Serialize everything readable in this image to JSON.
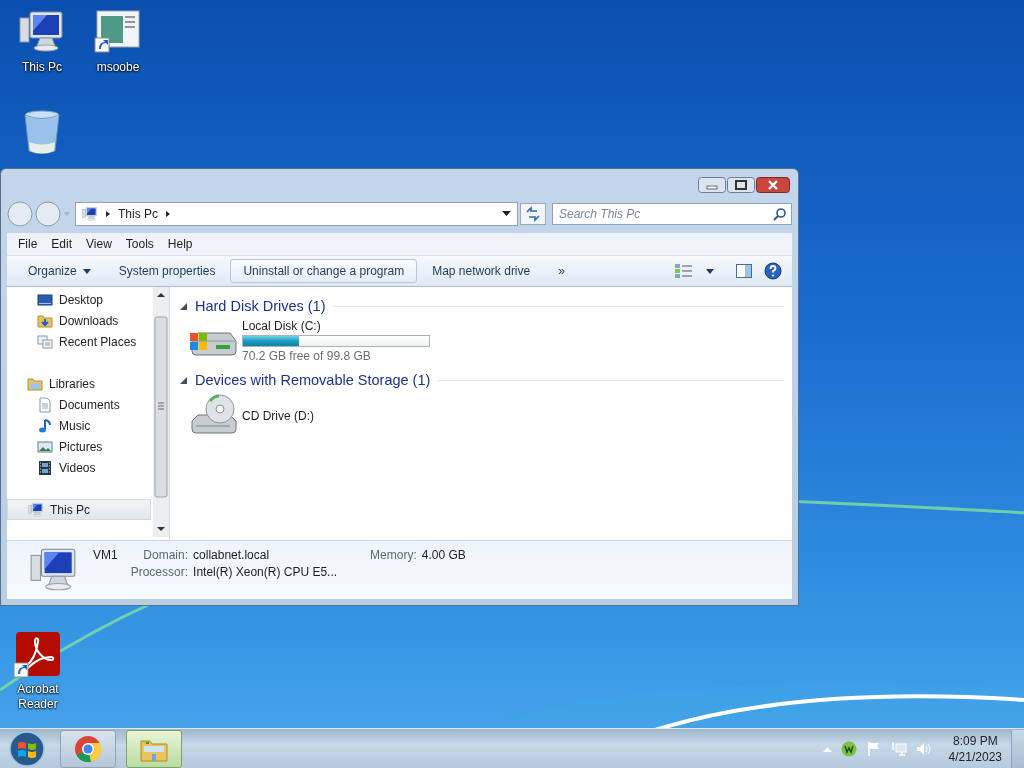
{
  "desktop": {
    "icons": [
      {
        "label": "This Pc",
        "kind": "computer"
      },
      {
        "label": "msoobe",
        "kind": "app-shortcut"
      },
      {
        "kind": "recycle-bin"
      },
      {
        "label": "Acrobat Reader",
        "kind": "pdf-shortcut"
      }
    ]
  },
  "window": {
    "breadcrumb": [
      "This Pc"
    ],
    "search": {
      "placeholder": "Search This Pc"
    },
    "menu": [
      "File",
      "Edit",
      "View",
      "Tools",
      "Help"
    ],
    "toolbar": [
      {
        "label": "Organize",
        "kind": "dropdown",
        "hovered": false
      },
      {
        "label": "System properties",
        "kind": "command",
        "hovered": false
      },
      {
        "label": "Uninstall or change a program",
        "kind": "command",
        "hovered": true
      },
      {
        "label": "Map network drive",
        "kind": "command",
        "hovered": false
      },
      {
        "label": "»",
        "kind": "overflow",
        "hovered": false
      }
    ],
    "sidebar": {
      "sections": [
        {
          "items": [
            {
              "label": "Desktop",
              "kind": "desktop",
              "selected": false
            },
            {
              "label": "Downloads",
              "kind": "downloads",
              "selected": false
            },
            {
              "label": "Recent Places",
              "kind": "recent",
              "selected": false
            }
          ]
        },
        {
          "label": "Libraries",
          "kind": "libraries",
          "selected": false,
          "children": [
            {
              "label": "Documents",
              "kind": "documents",
              "selected": false
            },
            {
              "label": "Music",
              "kind": "music",
              "selected": false
            },
            {
              "label": "Pictures",
              "kind": "pictures",
              "selected": false
            },
            {
              "label": "Videos",
              "kind": "videos",
              "selected": false
            }
          ]
        },
        {
          "label": "This Pc",
          "kind": "computer",
          "selected": true
        }
      ]
    },
    "groups": [
      {
        "title": "Hard Disk Drives (1)",
        "expanded": true,
        "items": [
          {
            "name": "Local Disk (C:)",
            "kind": "hard-disk",
            "level": 0.3,
            "free": "70.2 GB free of 99.8 GB"
          }
        ]
      },
      {
        "title": "Devices with Removable Storage (1)",
        "expanded": true,
        "items": [
          {
            "name": "CD Drive (D:)",
            "kind": "cd-drive"
          }
        ]
      }
    ],
    "details": {
      "name": "VM1",
      "rows": [
        [
          {
            "label": "Domain:",
            "value": "collabnet.local"
          },
          {
            "label": "Memory:",
            "value": "4.00 GB"
          }
        ],
        [
          {
            "label": "Processor:",
            "value": "Intel(R) Xeon(R) CPU E5..."
          }
        ]
      ]
    }
  },
  "taskbar": {
    "buttons": [
      {
        "kind": "browser",
        "selected": false
      },
      {
        "kind": "explorer",
        "selected": true
      }
    ],
    "tray": {
      "time": "8:09 PM",
      "date": "4/21/2023"
    }
  }
}
